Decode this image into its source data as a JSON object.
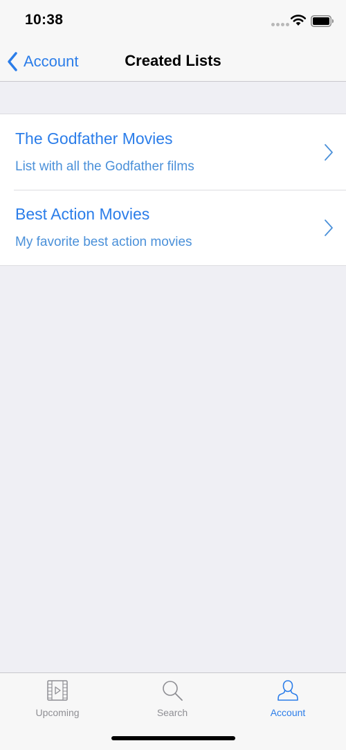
{
  "status_bar": {
    "time": "10:38"
  },
  "nav_bar": {
    "back_label": "Account",
    "title": "Created Lists"
  },
  "lists": [
    {
      "title": "The Godfather Movies",
      "subtitle": "List with all the Godfather films"
    },
    {
      "title": "Best Action Movies",
      "subtitle": "My favorite best action movies"
    }
  ],
  "tab_bar": {
    "tabs": [
      {
        "label": "Upcoming",
        "icon": "film-icon",
        "active": false
      },
      {
        "label": "Search",
        "icon": "search-icon",
        "active": false
      },
      {
        "label": "Account",
        "icon": "person-icon",
        "active": true
      }
    ]
  },
  "colors": {
    "accent": "#2b7de9",
    "inactive": "#8e8e93",
    "background": "#efeff4"
  }
}
